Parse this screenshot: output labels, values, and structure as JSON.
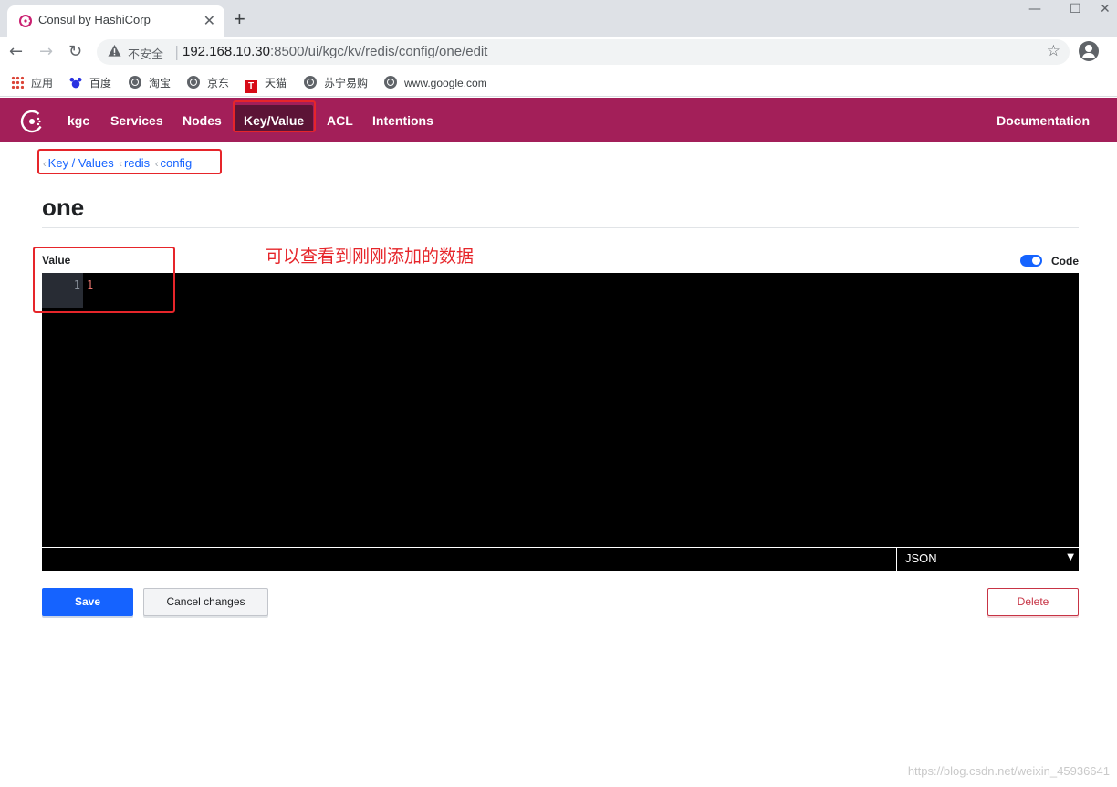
{
  "browser": {
    "tab_title": "Consul by HashiCorp",
    "insecure_label": "不安全",
    "url_host": "192.168.10.30",
    "url_rest": ":8500/ui/kgc/kv/redis/config/one/edit",
    "bookmarks": [
      "应用",
      "百度",
      "淘宝",
      "京东",
      "天猫",
      "苏宁易购",
      "www.google.com"
    ]
  },
  "consul_nav": {
    "datacenter": "kgc",
    "items": [
      "Services",
      "Nodes",
      "Key/Value",
      "ACL",
      "Intentions"
    ],
    "active": "Key/Value",
    "documentation": "Documentation",
    "brand_color": "#a31f59"
  },
  "breadcrumb": [
    "Key / Values",
    "redis",
    "config"
  ],
  "page_title": "one",
  "form": {
    "value_label": "Value",
    "code_toggle_label": "Code",
    "code_toggle_on": true,
    "editor": {
      "line_number": "1",
      "line_value": "1"
    },
    "mode": "JSON",
    "save_label": "Save",
    "cancel_label": "Cancel changes",
    "delete_label": "Delete"
  },
  "annotation": {
    "text": "可以查看到刚刚添加的数据",
    "color": "#e6252a"
  },
  "watermark": "https://blog.csdn.net/weixin_45936641"
}
